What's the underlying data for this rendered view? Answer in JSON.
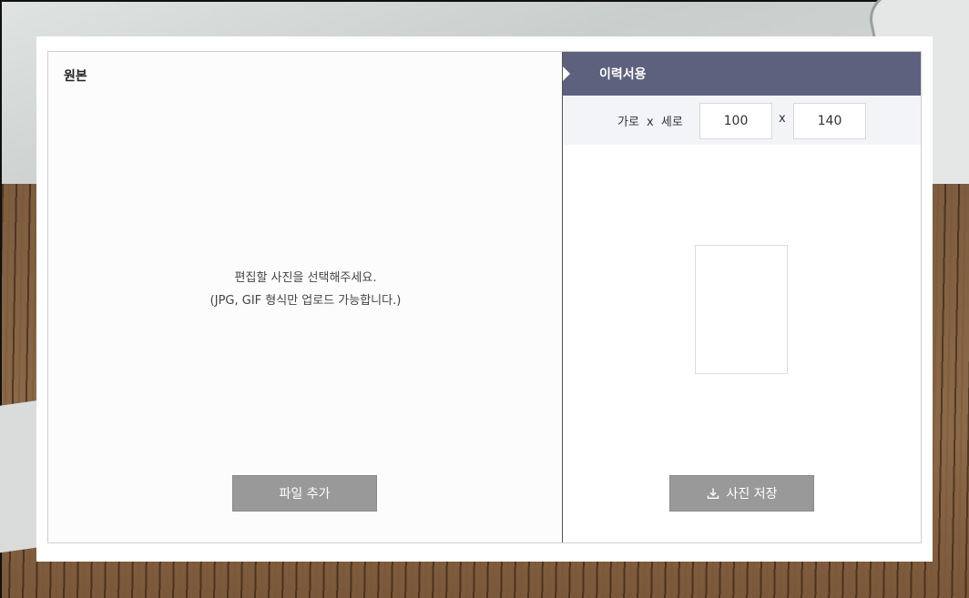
{
  "original": {
    "title": "원본",
    "message_line1": "편집할 사진을 선택해주세요.",
    "message_line2": "(JPG, GIF 형식만 업로드 가능합니다.)",
    "add_button": "파일 추가"
  },
  "resume": {
    "title": "이력서용",
    "size_label": "가로 x 세로",
    "width_value": "100",
    "separator": "x",
    "height_value": "140",
    "save_button": "사진 저장",
    "save_icon": "download-icon"
  },
  "colors": {
    "header_bg": "#5d617e",
    "button_bg": "#999999"
  }
}
